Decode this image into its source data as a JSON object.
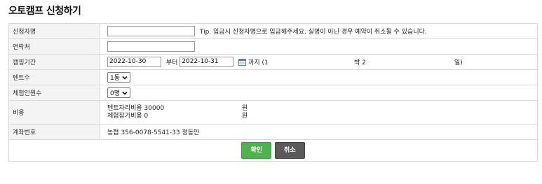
{
  "page": {
    "title": "오토캠프 신청하기"
  },
  "form": {
    "applicant": {
      "label": "신청자명",
      "value": "",
      "tip": "Tip. 입금시 신청자명으로 입금해주세요. 실명이 아닌 경우 예약이 취소될 수 있습니다."
    },
    "contact": {
      "label": "연락처",
      "value": ""
    },
    "period": {
      "label": "캠핑기간",
      "start": "2022-10-30",
      "from_text": "부터",
      "end": "2022-10-31",
      "to_text": "까지 (1",
      "nights_text": "박 2",
      "days_text": "일)"
    },
    "tents": {
      "label": "텐트수",
      "selected": "1동"
    },
    "experience": {
      "label": "체험인원수",
      "selected": "0명"
    },
    "cost": {
      "label": "비용",
      "tent_site_text": "텐트자리비용 30000",
      "experience_text": "체험참가비용 0",
      "unit": "원"
    },
    "account": {
      "label": "계좌번호",
      "value": "농협 356-0078-5541-33 정동만"
    }
  },
  "buttons": {
    "confirm": "확인",
    "cancel": "취소"
  },
  "colors": {
    "confirm": "#4db34d",
    "cancel": "#5a5a5a",
    "label_bg": "#f4f4f4",
    "border": "#d8d8d8"
  }
}
